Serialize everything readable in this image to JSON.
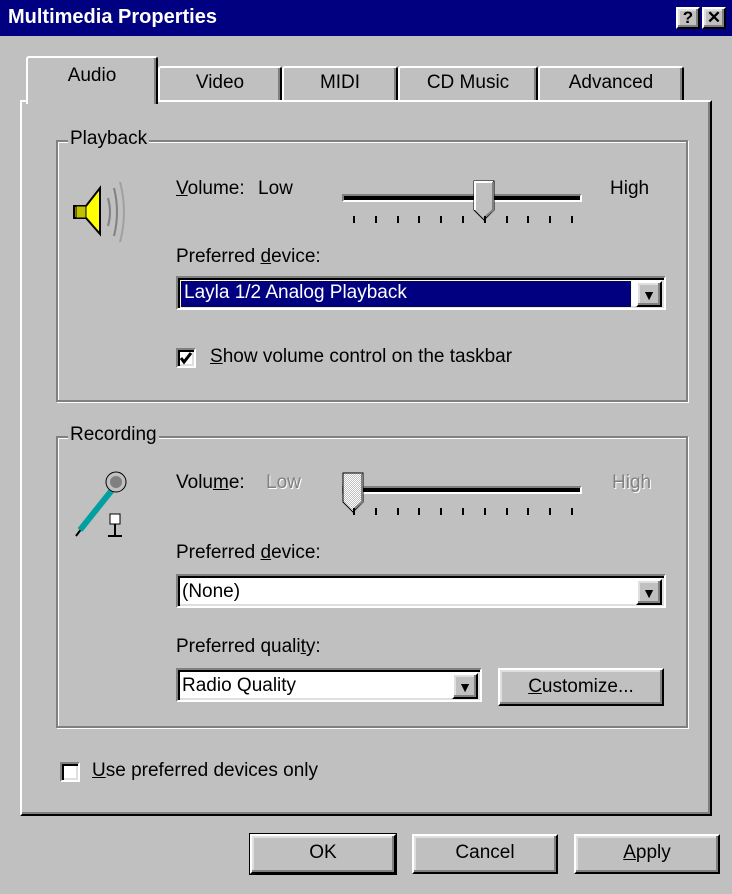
{
  "window": {
    "title": "Multimedia Properties",
    "help_button": "?",
    "close_button": "✕"
  },
  "tabs": [
    {
      "label": "Audio",
      "active": true
    },
    {
      "label": "Video",
      "active": false
    },
    {
      "label": "MIDI",
      "active": false
    },
    {
      "label": "CD Music",
      "active": false
    },
    {
      "label": "Advanced",
      "active": false
    }
  ],
  "playback": {
    "legend": "Playback",
    "icon": "speaker-icon",
    "volume_label_prefix": "V",
    "volume_label_rest": "olume:",
    "low": "Low",
    "high": "High",
    "volume_level": 0.6,
    "device_label_prefix": "Preferred ",
    "device_label_underlined": "d",
    "device_label_rest": "evice:",
    "device_value": "Layla 1/2 Analog Playback",
    "show_volume_checked": true,
    "show_volume_underlined": "S",
    "show_volume_rest": "how volume control on the taskbar"
  },
  "recording": {
    "legend": "Recording",
    "icon": "microphone-icon",
    "volume_label_prefix": "Volu",
    "volume_label_underlined": "m",
    "volume_label_rest": "e:",
    "low": "Low",
    "high": "High",
    "volume_level": 0.0,
    "device_label_prefix": "Preferred ",
    "device_label_underlined": "d",
    "device_label_rest": "evice:",
    "device_value": "(None)",
    "quality_label_prefix": "Preferred quali",
    "quality_label_underlined": "t",
    "quality_label_rest": "y:",
    "quality_value": "Radio Quality",
    "customize_underlined": "C",
    "customize_rest": "ustomize..."
  },
  "use_preferred": {
    "checked": false,
    "underlined": "U",
    "rest": "se preferred devices only"
  },
  "buttons": {
    "ok": "OK",
    "cancel": "Cancel",
    "apply_underlined": "A",
    "apply_rest": "pply"
  },
  "colors": {
    "title_bar": "#000080",
    "selection": "#000080",
    "face": "#c0c0c0"
  }
}
